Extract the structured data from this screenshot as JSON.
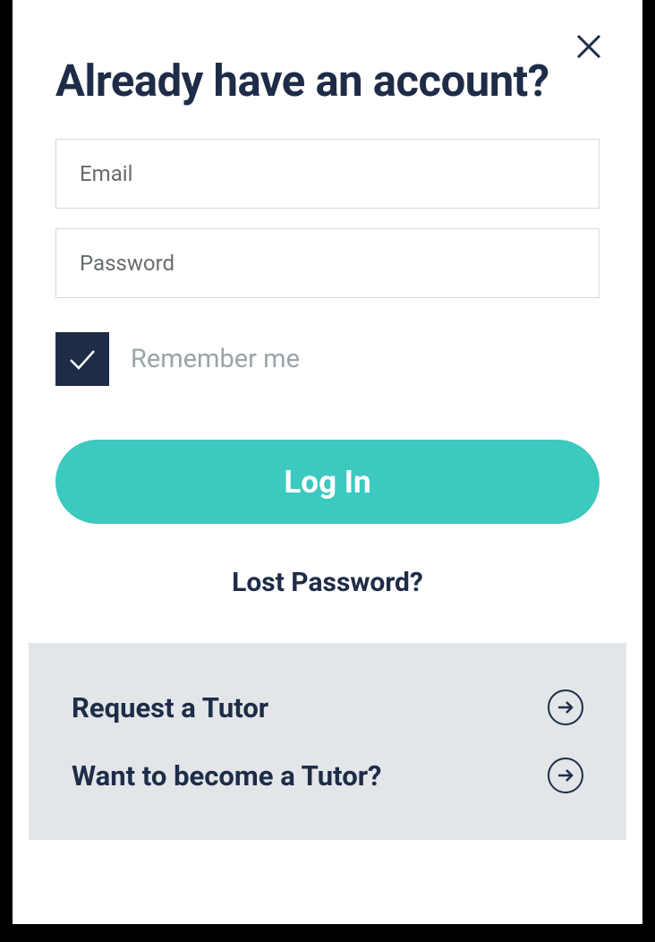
{
  "modal": {
    "heading": "Already have an account?",
    "email_placeholder": "Email",
    "password_placeholder": "Password",
    "remember_label": "Remember me",
    "login_button": "Log In",
    "lost_password": "Lost Password?"
  },
  "footer": {
    "request_tutor": "Request a Tutor",
    "become_tutor": "Want to become a Tutor?"
  }
}
